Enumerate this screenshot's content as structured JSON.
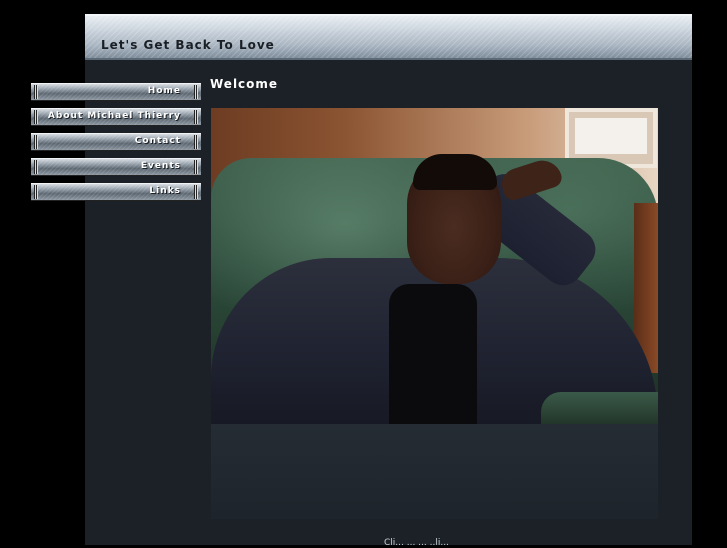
{
  "header": {
    "title": "Let's Get Back To Love"
  },
  "main": {
    "heading": "Welcome"
  },
  "nav": {
    "items": [
      {
        "label": "Home"
      },
      {
        "label": "About Michael Thierry"
      },
      {
        "label": "Contact"
      },
      {
        "label": "Events"
      },
      {
        "label": "Links"
      }
    ]
  },
  "footer": {
    "caption": "Cli... ... ... ..li..."
  },
  "colors": {
    "page_background": "#000000",
    "content_background": "#1c2127",
    "header_silver": "#c9d2db",
    "nav_text": "#ffffff"
  }
}
